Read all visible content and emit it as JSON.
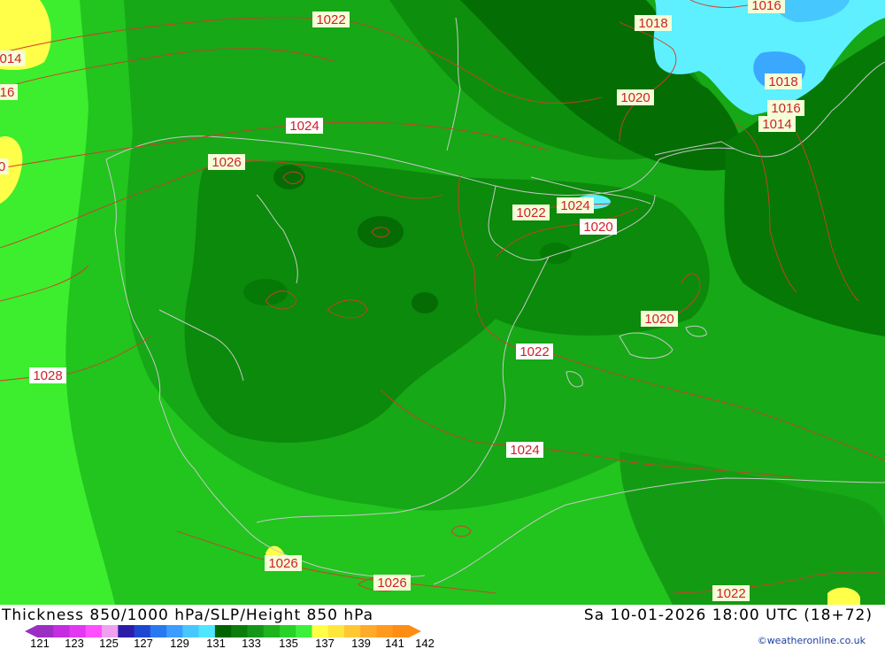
{
  "title": "Thickness 850/1000 hPa/SLP/Height 850 hPa",
  "datetime": "Sa 10-01-2026 18:00 UTC (18+72)",
  "credit": "©weatheronline.co.uk",
  "legend": {
    "ticks": [
      "121",
      "123",
      "125",
      "127",
      "129",
      "131",
      "133",
      "135",
      "137",
      "139",
      "141",
      "142"
    ],
    "colors": [
      "#9b2fc4",
      "#c42ee0",
      "#e238f2",
      "#ff50ff",
      "#f0a0f0",
      "#2a1ea8",
      "#1e46d2",
      "#2878f0",
      "#3c9cff",
      "#46c8ff",
      "#50e6ff",
      "#006400",
      "#0a7d0a",
      "#14961a",
      "#1eb41e",
      "#28d228",
      "#3cf03c",
      "#ffff46",
      "#ffe63c",
      "#ffc832",
      "#ffaa28",
      "#ff9a1e",
      "#ff8c14"
    ]
  },
  "isobars": [
    {
      "label": "1022"
    },
    {
      "label": "1018"
    },
    {
      "label": "1016"
    },
    {
      "label": "014"
    },
    {
      "label": "16"
    },
    {
      "label": "1020"
    },
    {
      "label": "1024"
    },
    {
      "label": "1026"
    },
    {
      "label": "0"
    },
    {
      "label": "1018"
    },
    {
      "label": "1016"
    },
    {
      "label": "1014"
    },
    {
      "label": "1022"
    },
    {
      "label": "1024"
    },
    {
      "label": "1020"
    },
    {
      "label": "1020"
    },
    {
      "label": "1028"
    },
    {
      "label": "1022"
    },
    {
      "label": "1024"
    },
    {
      "label": "1026"
    },
    {
      "label": "1026"
    },
    {
      "label": "1022"
    }
  ]
}
